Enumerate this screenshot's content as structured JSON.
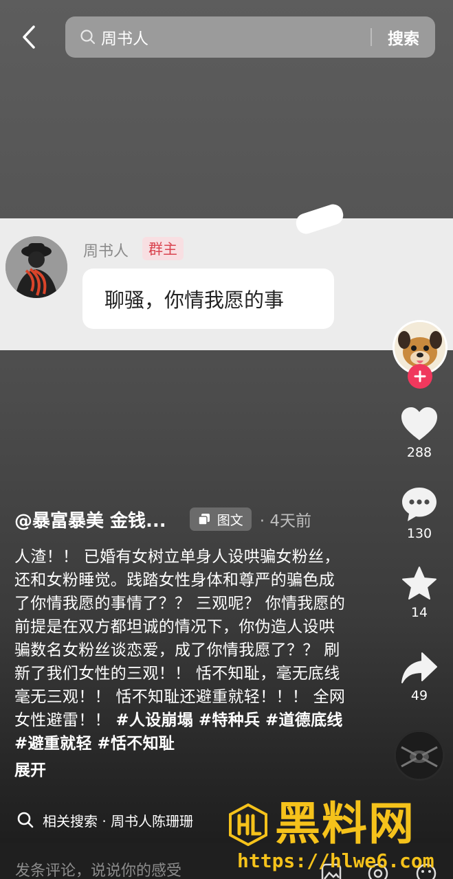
{
  "search": {
    "query": "周书人",
    "button_label": "搜索"
  },
  "chat": {
    "name": "周书人",
    "badge": "群主",
    "message": "聊骚，你情我愿的事"
  },
  "actions": {
    "like_count": "288",
    "comment_count": "130",
    "favorite_count": "14",
    "share_count": "49"
  },
  "post": {
    "author": "@暴富暴美 金钱...",
    "type_tag": "图文",
    "time": "· 4天前",
    "body": "人渣！！ 已婚有女树立单身人设哄骗女粉丝，还和女粉睡觉。践踏女性身体和尊严的骗色成了你情我愿的事情了？？ 三观呢？ 你情我愿的前提是在双方都坦诚的情况下，你伪造人设哄骗数名女粉丝谈恋爱，成了你情我愿了？？ 刷新了我们女性的三观！！ 恬不知耻，毫无底线毫无三观！！ 恬不知耻还避重就轻！！！ 全网女性避雷！！ ",
    "hashtags": [
      "#人设崩塌",
      "#特种兵",
      "#道德底线",
      "#避重就轻",
      "#恬不知耻"
    ],
    "expand_label": "展开"
  },
  "related": {
    "label": "相关搜索 · 周书人陈珊珊"
  },
  "comment_bar": {
    "placeholder": "发条评论，说说你的感受"
  },
  "watermark": {
    "title": "黑料网",
    "url": "https://hlwe6.com"
  },
  "colors": {
    "follow_red": "#f0385d",
    "badge_red": "#d9434f",
    "watermark_yellow": "#f5c21b"
  },
  "icons": [
    "back-arrow-icon",
    "search-icon",
    "plus-icon",
    "heart-icon",
    "comment-icon",
    "star-icon",
    "share-icon",
    "image-text-icon",
    "at-icon",
    "emoji-icon"
  ]
}
